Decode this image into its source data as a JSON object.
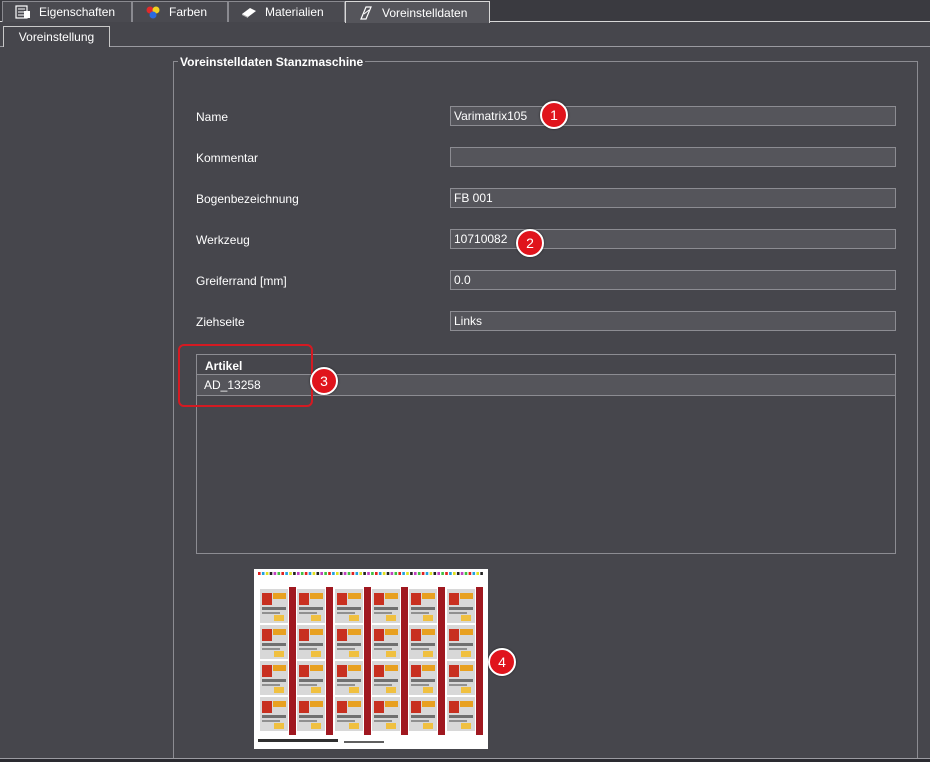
{
  "tabs": [
    {
      "label": "Eigenschaften",
      "icon": "properties-icon"
    },
    {
      "label": "Farben",
      "icon": "colors-icon"
    },
    {
      "label": "Materialien",
      "icon": "materials-icon"
    },
    {
      "label": "Voreinstelldaten",
      "icon": "preset-data-icon",
      "active": true
    }
  ],
  "subtabs": [
    {
      "label": "Voreinstellung"
    }
  ],
  "group": {
    "title": "Voreinstelldaten Stanzmaschine",
    "fields": [
      {
        "label": "Name",
        "value": "Varimatrix105"
      },
      {
        "label": "Kommentar",
        "value": ""
      },
      {
        "label": "Bogenbezeichnung",
        "value": "FB 001"
      },
      {
        "label": "Werkzeug",
        "value": "10710082"
      },
      {
        "label": "Greiferrand [mm]",
        "value": "0.0"
      },
      {
        "label": "Ziehseite",
        "value": "Links"
      }
    ]
  },
  "articles": {
    "header": "Artikel",
    "rows": [
      "AD_13258"
    ]
  },
  "callouts": [
    "1",
    "2",
    "3",
    "4"
  ],
  "colors": {
    "background": "#46464c",
    "field": "#55555b",
    "callout": "#e0141c",
    "sheet_red": "#a01820"
  }
}
